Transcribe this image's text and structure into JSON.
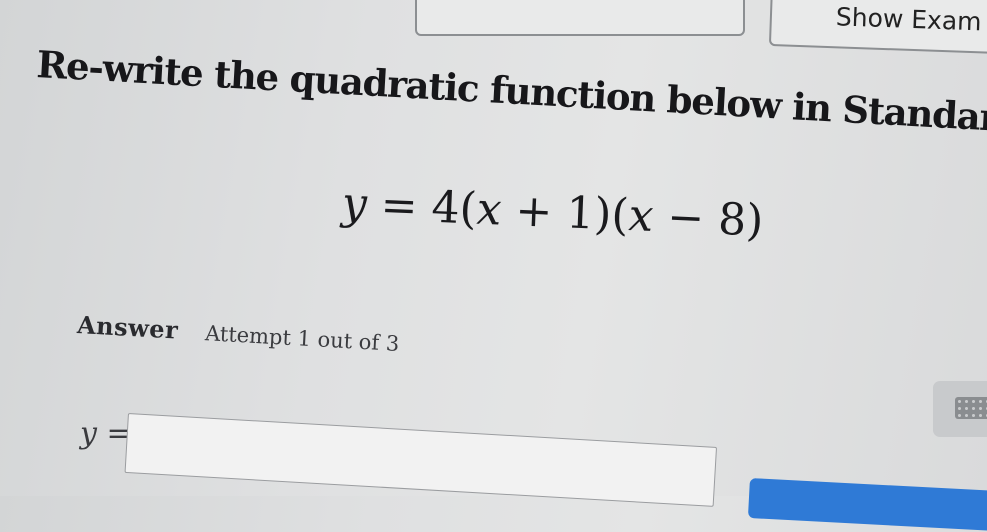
{
  "header": {
    "show_example_label": "Show Exam"
  },
  "question": {
    "prompt": "Re-write the quadratic function below in Standard Form.",
    "equation": {
      "lhs_var": "y",
      "equals": "=",
      "coefficient": "4",
      "factor1_open": "(",
      "factor1_var": "x",
      "factor1_rest": " + 1)",
      "factor2_open": "(",
      "factor2_var": "x",
      "factor2_rest": " − 8)"
    }
  },
  "answer": {
    "label": "Answer",
    "attempt": "Attempt 1 out of 3",
    "lhs_var": "y",
    "equals": "=",
    "input_value": ""
  }
}
